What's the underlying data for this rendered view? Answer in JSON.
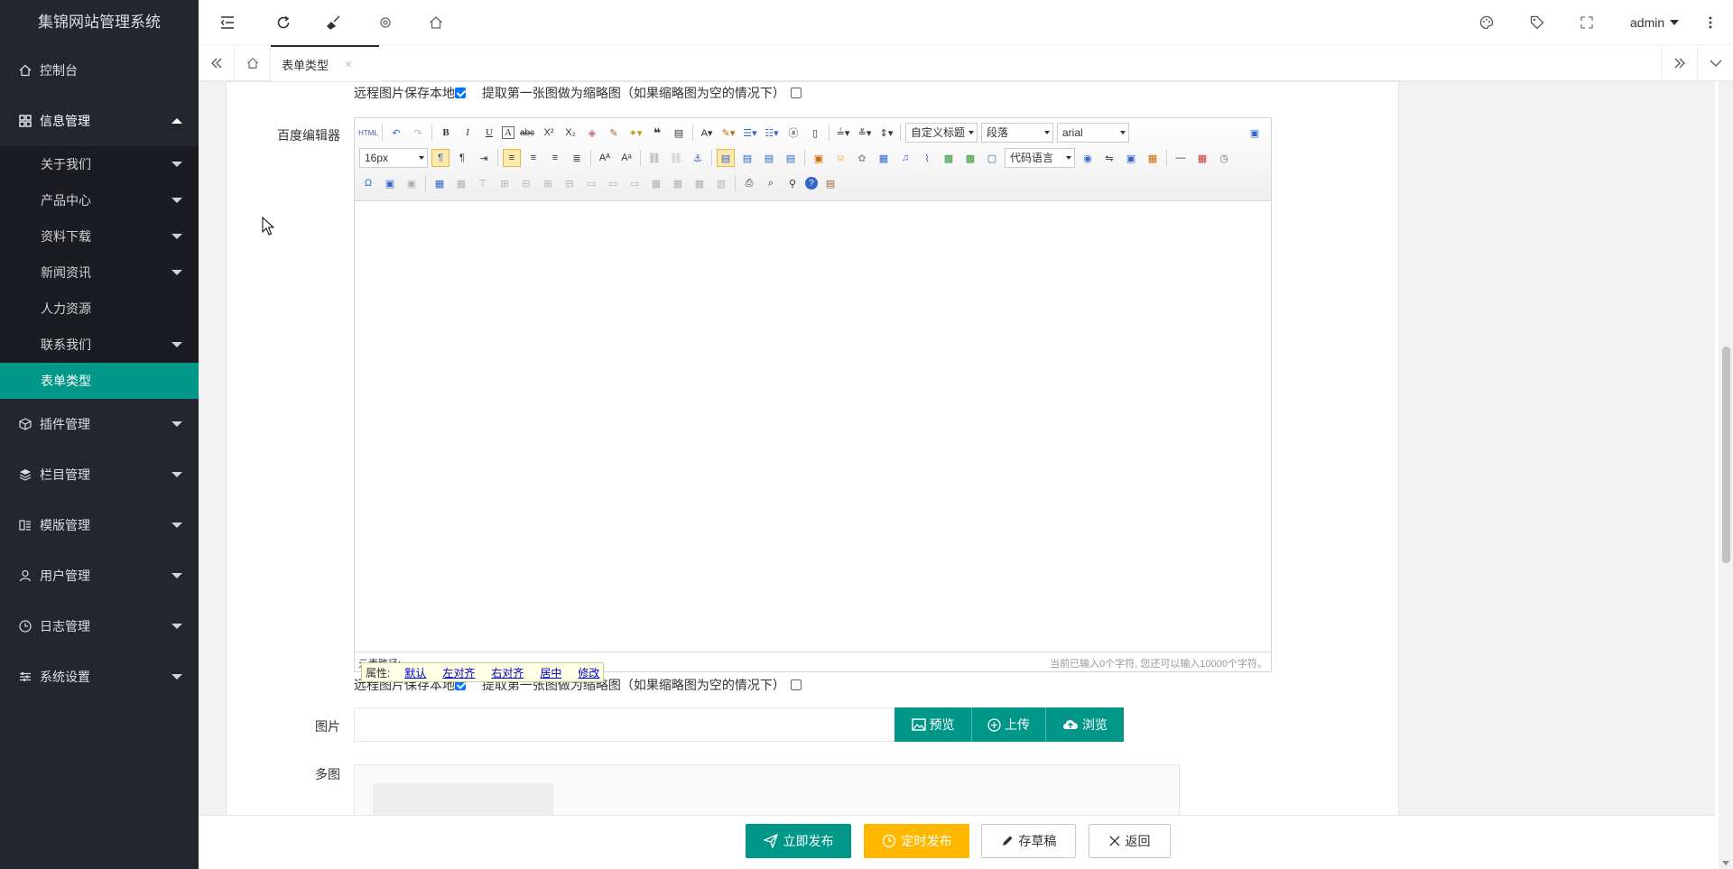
{
  "app": {
    "title": "集锦网站管理系统"
  },
  "sidebar": {
    "items": [
      {
        "label": "控制台",
        "icon": "home-icon"
      },
      {
        "label": "信息管理",
        "icon": "grid-icon",
        "open": true,
        "children": [
          {
            "label": "关于我们",
            "has_arrow": true
          },
          {
            "label": "产品中心",
            "has_arrow": true
          },
          {
            "label": "资料下载",
            "has_arrow": true
          },
          {
            "label": "新闻资讯",
            "has_arrow": true
          },
          {
            "label": "人力资源",
            "has_arrow": false
          },
          {
            "label": "联系我们",
            "has_arrow": true
          },
          {
            "label": "表单类型",
            "has_arrow": false,
            "active": true
          }
        ]
      },
      {
        "label": "插件管理",
        "icon": "cube-icon"
      },
      {
        "label": "栏目管理",
        "icon": "layers-icon"
      },
      {
        "label": "模版管理",
        "icon": "template-icon"
      },
      {
        "label": "用户管理",
        "icon": "user-icon"
      },
      {
        "label": "日志管理",
        "icon": "clock-icon"
      },
      {
        "label": "系统设置",
        "icon": "sliders-icon"
      }
    ]
  },
  "topbar": {
    "user": "admin"
  },
  "tabs": {
    "active_tab": "表单类型",
    "close": "×"
  },
  "form": {
    "remote_save_label": "远程图片保存本地",
    "thumb_label": "提取第一张图做为缩略图（如果缩略图为空的情况下）",
    "editor_label": "百度编辑器",
    "image_label": "图片",
    "multi_label": "多图",
    "preview_btn": "预览",
    "upload_btn": "上传",
    "browse_btn": "浏览"
  },
  "editor": {
    "font_size": "16px",
    "custom_title": "自定义标题",
    "paragraph": "段落",
    "font_family": "arial",
    "code_lang": "代码语言",
    "path_label": "元素路径:",
    "word_count": "当前已输入0个字符, 您还可以输入10000个字符。",
    "popup": {
      "label": "属性:",
      "links": [
        "默认",
        "左对齐",
        "右对齐",
        "居中",
        "修改"
      ]
    }
  },
  "actions": {
    "publish": "立即发布",
    "schedule": "定时发布",
    "draft": "存草稿",
    "back": "返回"
  },
  "colors": {
    "sidebar": "#23262e",
    "accent": "#009688",
    "warning": "#ffb800"
  }
}
